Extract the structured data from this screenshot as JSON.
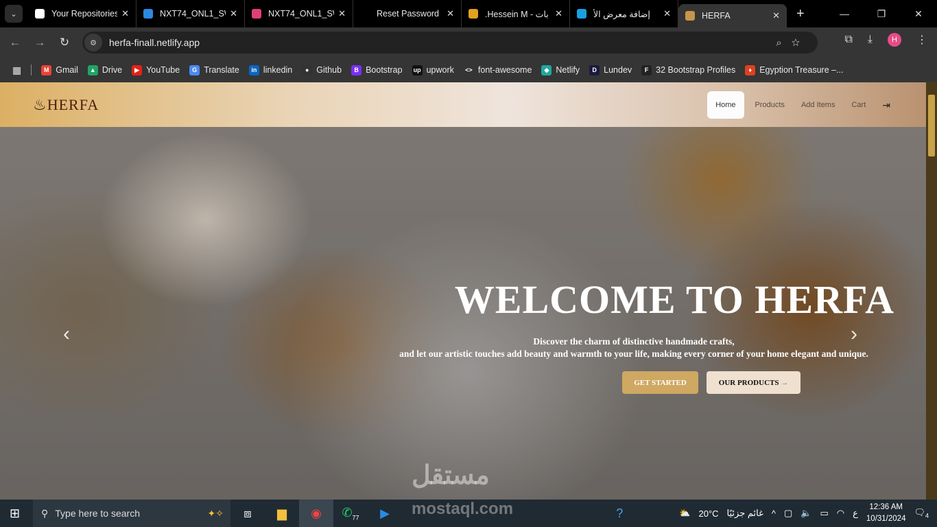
{
  "browser": {
    "tabs": [
      {
        "title": "Your Repositories",
        "icon": "github-icon",
        "color": "#ffffff"
      },
      {
        "title": "NXT74_ONL1_SW",
        "icon": "onedrive-icon",
        "color": "#2a8ae0"
      },
      {
        "title": "NXT74_ONL1_SW",
        "icon": "play-icon",
        "color": "#e0407a"
      },
      {
        "title": "Reset Password",
        "icon": "upwork-icon",
        "color": "#000000"
      },
      {
        "title": ".Hessein M - بات",
        "icon": "badge-5-icon",
        "color": "#e0a020"
      },
      {
        "title": "إضافة معرض الأ",
        "icon": "circle-icon",
        "color": "#1aa0e0"
      },
      {
        "title": "HERFA",
        "icon": "herfa-icon",
        "color": "#c8954a",
        "active": true
      }
    ],
    "url": "herfa-finall.netlify.app",
    "profile_initial": "H",
    "bookmarks": [
      {
        "label": "Gmail",
        "color": "#ea4335",
        "glyph": "M"
      },
      {
        "label": "Drive",
        "color": "#1fa463",
        "glyph": "▲"
      },
      {
        "label": "YouTube",
        "color": "#e62117",
        "glyph": "▶"
      },
      {
        "label": "Translate",
        "color": "#4a8af4",
        "glyph": "G"
      },
      {
        "label": "linkedin",
        "color": "#0a66c2",
        "glyph": "in"
      },
      {
        "label": "Github",
        "color": "#333333",
        "glyph": "●"
      },
      {
        "label": "Bootstrap",
        "color": "#7b2ff7",
        "glyph": "B"
      },
      {
        "label": "upwork",
        "color": "#111111",
        "glyph": "up"
      },
      {
        "label": "font-awesome",
        "color": "#353535",
        "glyph": "<>"
      },
      {
        "label": "Netlify",
        "color": "#20a8a0",
        "glyph": "◆"
      },
      {
        "label": "Lundev",
        "color": "#1a1a40",
        "glyph": "D"
      },
      {
        "label": "32 Bootstrap Profiles",
        "color": "#222222",
        "glyph": "F"
      },
      {
        "label": "Egyption Treasure –...",
        "color": "#e04020",
        "glyph": "♦"
      }
    ]
  },
  "site": {
    "logo": "HERFA",
    "nav": [
      "Home",
      "Products",
      "Add Items",
      "Cart"
    ],
    "active_nav": "Home",
    "hero_title": "WELCOME TO HERFA",
    "hero_line1": "Discover the charm of distinctive handmade crafts,",
    "hero_line2": "and let our artistic touches add beauty and warmth to your life, making every corner of your home elegant and unique.",
    "btn_start": "GET STARTED",
    "btn_products": "OUR PRODUCTS",
    "colors": {
      "accent": "#cfa862",
      "secondary": "#efe0cf"
    }
  },
  "watermark": "مستقل",
  "taskbar": {
    "search_placeholder": "Type here to search",
    "whatsapp_badge": "77",
    "weather": "20°C",
    "weather_text": "غائم جزئيًا",
    "lang": "ع",
    "time": "12:36 AM",
    "date": "10/31/2024",
    "notifications": "4",
    "watermark_text": "mostaql.com"
  }
}
